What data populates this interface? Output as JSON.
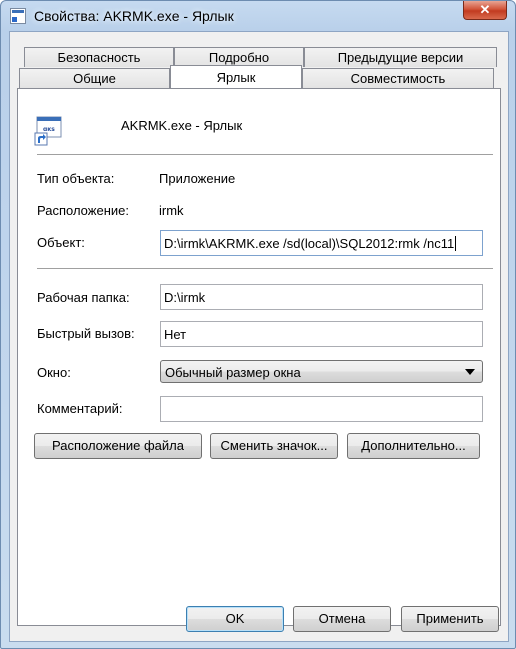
{
  "window": {
    "title": "Свойства: AKRMK.exe - Ярлык",
    "close_label": "✕"
  },
  "tabs": {
    "row1": [
      "Безопасность",
      "Подробно",
      "Предыдущие версии"
    ],
    "row2": [
      "Общие",
      "Ярлык",
      "Совместимость"
    ],
    "active": "Ярлык"
  },
  "shortcut": {
    "name": "AKRMK.exe - Ярлык"
  },
  "info": {
    "type_label": "Тип объекта:",
    "type_value": "Приложение",
    "location_label": "Расположение:",
    "location_value": "irmk",
    "target_label": "Объект:",
    "target_value": "D:\\irmk\\AKRMK.exe /sd(local)\\SQL2012:rmk /nc11"
  },
  "fields": {
    "workdir_label": "Рабочая папка:",
    "workdir_value": "D:\\irmk",
    "hotkey_label": "Быстрый вызов:",
    "hotkey_value": "Нет",
    "window_label": "Окно:",
    "window_value": "Обычный размер окна",
    "comment_label": "Комментарий:",
    "comment_value": ""
  },
  "actions": {
    "open_location": "Расположение файла",
    "change_icon": "Сменить значок...",
    "advanced": "Дополнительно..."
  },
  "footer": {
    "ok": "OK",
    "cancel": "Отмена",
    "apply": "Применить"
  }
}
